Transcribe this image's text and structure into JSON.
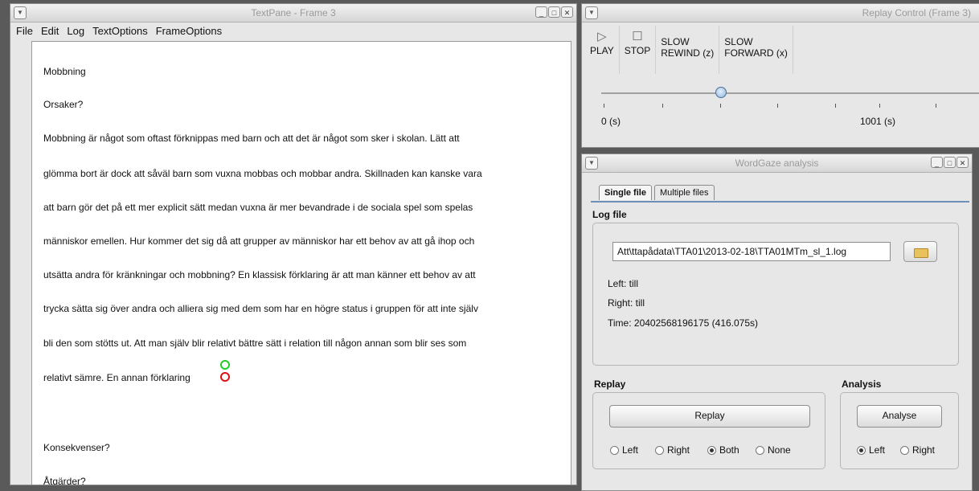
{
  "textpane": {
    "title": "TextPane - Frame 3",
    "menu": [
      "File",
      "Edit",
      "Log",
      "TextOptions",
      "FrameOptions"
    ],
    "lines": [
      "Mobbning",
      "Orsaker?",
      "Mobbning är något som oftast förknippas med barn och att det är något som sker i skolan. Lätt att",
      "glömma bort är dock att såväl barn som vuxna mobbas och mobbar andra. Skillnaden kan kanske vara",
      "att barn gör det på ett mer explicit sätt medan vuxna är mer bevandrade i de sociala spel som spelas",
      "människor emellen. Hur kommer det sig då att grupper av människor har ett behov av att gå ihop och",
      "utsätta andra för kränkningar och mobbning? En klassisk förklaring är att man känner ett behov av att",
      "trycka sätta sig över andra och alliera sig med dem som har en högre status i gruppen för att inte själv",
      "bli den som stötts ut. Att man själv blir relativt bättre sätt i relation till någon annan som blir ses som",
      "relativt sämre. En annan förklaring",
      "Konsekvenser?",
      "Åtgärder?"
    ]
  },
  "replay_control": {
    "title": "Replay Control (Frame 3)",
    "buttons": [
      {
        "label": "PLAY",
        "icon": "play-icon"
      },
      {
        "label": "STOP",
        "icon": "stop-icon"
      },
      {
        "label": "SLOW\nREWIND (z)"
      },
      {
        "label": "SLOW\nFORWARD (x)"
      }
    ],
    "slider": {
      "min_label": "0 (s)",
      "max_label": "1001 (s)",
      "position": 0.32
    }
  },
  "wordgaze": {
    "title": "WordGaze analysis",
    "tabs": [
      "Single file",
      "Multiple files"
    ],
    "log_file_label": "Log file",
    "log_path": "Att\\ttapådata\\TTA01\\2013-02-18\\TTA01MTm_sl_1.log",
    "left_line": "Left:  till",
    "right_line": "Right:  till",
    "time_line": "Time: 20402568196175 (416.075s)",
    "replay": {
      "label": "Replay",
      "button": "Replay",
      "options": [
        "Left",
        "Right",
        "Both",
        "None"
      ],
      "selected": "Both"
    },
    "analysis": {
      "label": "Analysis",
      "button": "Analyse",
      "options": [
        "Left",
        "Right"
      ],
      "selected": "Left"
    }
  },
  "colors": {
    "gaze_left": "#22cc22",
    "gaze_right": "#dd1111",
    "tab_accent": "#6f8fb8"
  }
}
